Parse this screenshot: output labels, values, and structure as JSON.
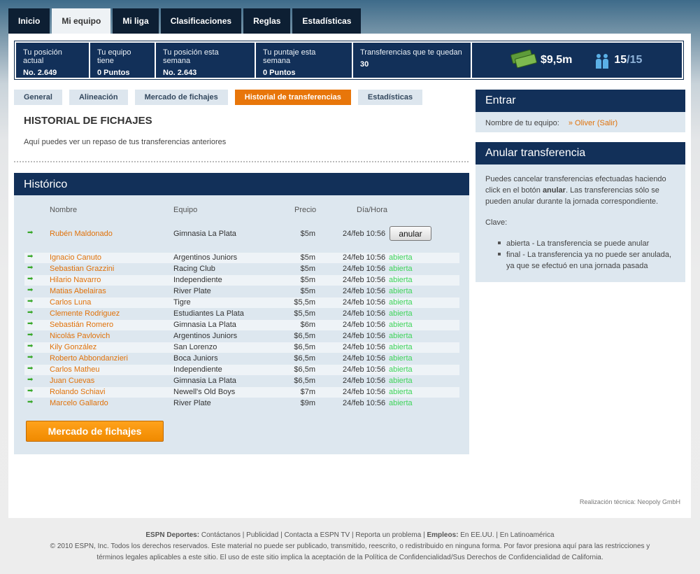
{
  "topnav": {
    "tabs": [
      {
        "label": "Inicio",
        "active": false
      },
      {
        "label": "Mi equipo",
        "active": true
      },
      {
        "label": "Mi liga",
        "active": false
      },
      {
        "label": "Clasificaciones",
        "active": false
      },
      {
        "label": "Reglas",
        "active": false
      },
      {
        "label": "Estadísticas",
        "active": false
      }
    ]
  },
  "stats": {
    "items": [
      {
        "label": "Tu posición actual",
        "value": "No. 2.649"
      },
      {
        "label": "Tu equipo tiene",
        "value": "0 Puntos"
      },
      {
        "label": "Tu posición esta semana",
        "value": "No. 2.643"
      },
      {
        "label": "Tu puntaje esta semana",
        "value": "0 Puntos"
      },
      {
        "label": "Transferencias que te quedan",
        "value": "30"
      }
    ],
    "money": "$9,5m",
    "players_current": "15",
    "players_sep_total": "/15",
    "money_icon": "money-icon",
    "players_icon": "people-icon"
  },
  "subtabs": [
    {
      "label": "General",
      "active": false
    },
    {
      "label": "Alineación",
      "active": false
    },
    {
      "label": "Mercado de fichajes",
      "active": false
    },
    {
      "label": "Historial de transferencias",
      "active": true
    },
    {
      "label": "Estadísticas",
      "active": false
    }
  ],
  "main": {
    "title": "HISTORIAL DE FICHAJES",
    "intro": "Aquí puedes ver un repaso de tus transferencias anteriores"
  },
  "history": {
    "title": "Histórico",
    "columns": {
      "name": "Nombre",
      "team": "Equipo",
      "price": "Precio",
      "date": "Día/Hora"
    },
    "first": {
      "name": "Rubén Maldonado",
      "team": "Gimnasia La Plata",
      "price": "$5m",
      "date": "24/feb 10:56",
      "action": "anular"
    },
    "rows": [
      {
        "name": "Ignacio Canuto",
        "team": "Argentinos Juniors",
        "price": "$5m",
        "date": "24/feb 10:56",
        "state": "abierta"
      },
      {
        "name": "Sebastian Grazzini",
        "team": "Racing Club",
        "price": "$5m",
        "date": "24/feb 10:56",
        "state": "abierta"
      },
      {
        "name": "Hilario Navarro",
        "team": "Independiente",
        "price": "$5m",
        "date": "24/feb 10:56",
        "state": "abierta"
      },
      {
        "name": "Matias Abelairas",
        "team": "River Plate",
        "price": "$5m",
        "date": "24/feb 10:56",
        "state": "abierta"
      },
      {
        "name": "Carlos Luna",
        "team": "Tigre",
        "price": "$5,5m",
        "date": "24/feb 10:56",
        "state": "abierta"
      },
      {
        "name": "Clemente Rodriguez",
        "team": "Estudiantes La Plata",
        "price": "$5,5m",
        "date": "24/feb 10:56",
        "state": "abierta"
      },
      {
        "name": "Sebastián Romero",
        "team": "Gimnasia La Plata",
        "price": "$6m",
        "date": "24/feb 10:56",
        "state": "abierta"
      },
      {
        "name": "Nicolás Pavlovich",
        "team": "Argentinos Juniors",
        "price": "$6,5m",
        "date": "24/feb 10:56",
        "state": "abierta"
      },
      {
        "name": "Kily González",
        "team": "San Lorenzo",
        "price": "$6,5m",
        "date": "24/feb 10:56",
        "state": "abierta"
      },
      {
        "name": "Roberto Abbondanzieri",
        "team": "Boca Juniors",
        "price": "$6,5m",
        "date": "24/feb 10:56",
        "state": "abierta"
      },
      {
        "name": "Carlos Matheu",
        "team": "Independiente",
        "price": "$6,5m",
        "date": "24/feb 10:56",
        "state": "abierta"
      },
      {
        "name": "Juan Cuevas",
        "team": "Gimnasia La Plata",
        "price": "$6,5m",
        "date": "24/feb 10:56",
        "state": "abierta"
      },
      {
        "name": "Rolando Schiavi",
        "team": "Newell's Old Boys",
        "price": "$7m",
        "date": "24/feb 10:56",
        "state": "abierta"
      },
      {
        "name": "Marcelo Gallardo",
        "team": "River Plate",
        "price": "$9m",
        "date": "24/feb 10:56",
        "state": "abierta"
      }
    ],
    "button": "Mercado de fichajes"
  },
  "entrar": {
    "title": "Entrar",
    "label": "Nombre de tu equipo:",
    "link": "» Oliver (Salir)"
  },
  "anular": {
    "title": "Anular transferencia",
    "text_before": "Puedes cancelar transferencias efectuadas haciendo click en el botón ",
    "text_bold": "anular",
    "text_after": ". Las transferencias sólo se pueden anular durante la jornada correspondiente.",
    "clave": "Clave:",
    "key1": "abierta - La transferencia se puede anular",
    "key2": "final - La transferencia ya no puede ser anulada, ya que se efectuó en una jornada pasada"
  },
  "credit": "Realización técnica: Neopoly GmbH",
  "footer": {
    "brand": "ESPN Deportes:",
    "links1": "Contáctanos | Publicidad | Contacta a ESPN TV | Reporta un problema |",
    "empleos": "Empleos:",
    "links2": "En EE.UU. | En Latinoamérica",
    "legal1": "© 2010 ESPN, Inc. Todos los derechos reservados. Este material no puede ser publicado, transmitido, reescrito, o redistribuido en ninguna forma. Por favor presiona aquí para las restricciones y",
    "legal2": "términos legales aplicables a este sitio. El uso de este sitio implica la aceptación de la Política de Confidencialidad/Sus Derechos de Confidencialidad de California."
  }
}
